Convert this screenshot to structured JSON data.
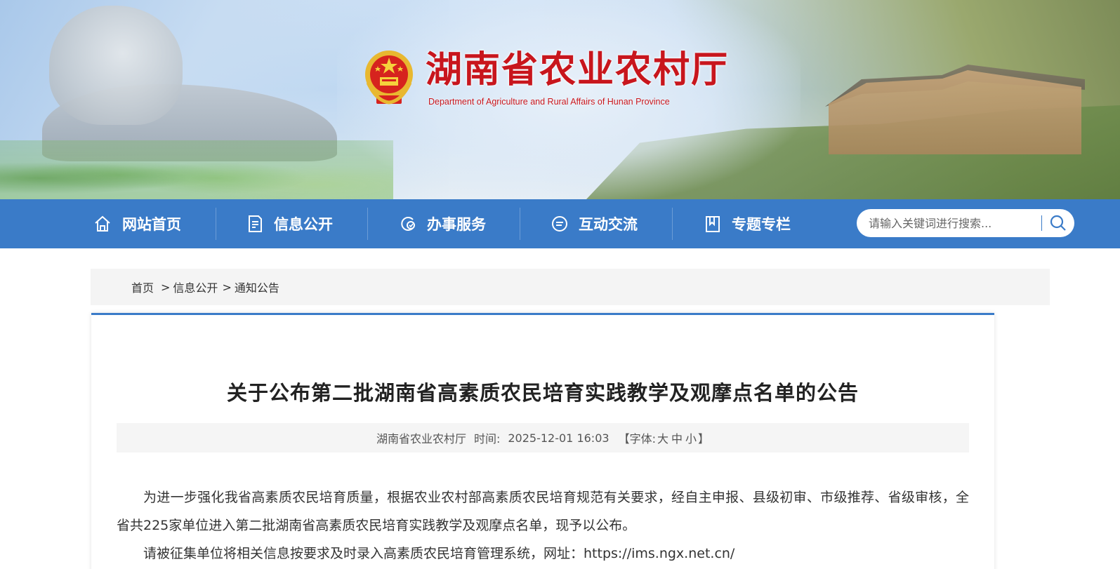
{
  "header": {
    "site_title": "湖南省农业农村厅",
    "site_subtitle": "Department of Agriculture and Rural Affairs of Hunan Province"
  },
  "nav": {
    "items": [
      {
        "label": "网站首页",
        "icon": "home-icon"
      },
      {
        "label": "信息公开",
        "icon": "document-icon"
      },
      {
        "label": "办事服务",
        "icon": "service-icon"
      },
      {
        "label": "互动交流",
        "icon": "chat-icon"
      },
      {
        "label": "专题专栏",
        "icon": "bookmark-icon"
      }
    ],
    "search_placeholder": "请输入关键词进行搜索..."
  },
  "breadcrumb": {
    "home": "首页",
    "level1": "信息公开",
    "level2": "通知公告",
    "separator": ">"
  },
  "article": {
    "title": "关于公布第二批湖南省高素质农民培育实践教学及观摩点名单的公告",
    "meta": {
      "source": "湖南省农业农村厅",
      "time_label": "时间:",
      "time": "2025-12-01 16:03",
      "font_label": "【字体:",
      "font_large": "大",
      "font_medium": "中",
      "font_small": "小",
      "font_close": "】"
    },
    "paragraphs": [
      "为进一步强化我省高素质农民培育质量，根据农业农村部高素质农民培育规范有关要求，经自主申报、县级初审、市级推荐、省级审核，全省共225家单位进入第二批湖南省高素质农民培育实践教学及观摩点名单，现予以公布。",
      "请被征集单位将相关信息按要求及时录入高素质农民培育管理系统，网址：https://ims.ngx.net.cn/"
    ]
  },
  "colors": {
    "nav_bg": "#3a7bc8",
    "title_red": "#c8161d"
  }
}
